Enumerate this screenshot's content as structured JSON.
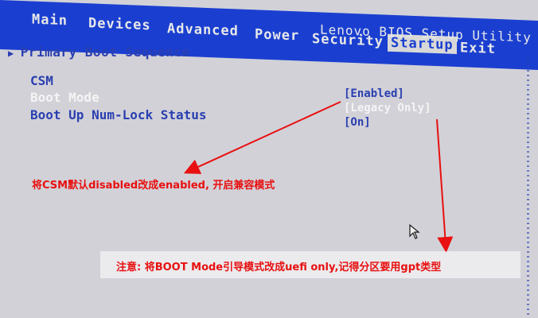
{
  "menu": {
    "tabs": [
      {
        "label": "Main"
      },
      {
        "label": "Devices"
      },
      {
        "label": "Advanced"
      },
      {
        "label": "Power"
      },
      {
        "label": "Security"
      },
      {
        "label": "Startup"
      },
      {
        "label": "Exit"
      }
    ],
    "active_tab": "Startup",
    "title": "Lenovo BIOS Setup Utility"
  },
  "section": {
    "header": "Primary Boot Sequence",
    "arrow_icon": "triangle-right"
  },
  "settings": [
    {
      "label": "CSM",
      "value": "[Enabled]"
    },
    {
      "label": "Boot Mode",
      "value": "[Legacy Only]"
    },
    {
      "label": "Boot Up Num-Lock Status",
      "value": "[On]"
    }
  ],
  "annotations": {
    "note1": "将CSM默认disabled改成enabled, 开启兼容模式",
    "note2": "注意: 将BOOT Mode引导模式改成uefi only,记得分区要用gpt类型"
  },
  "colors": {
    "header_blue": "#1a3fd0",
    "text_blue": "#2a3fb0",
    "background": "#d2d1d8",
    "annotation_red": "#e81010"
  }
}
